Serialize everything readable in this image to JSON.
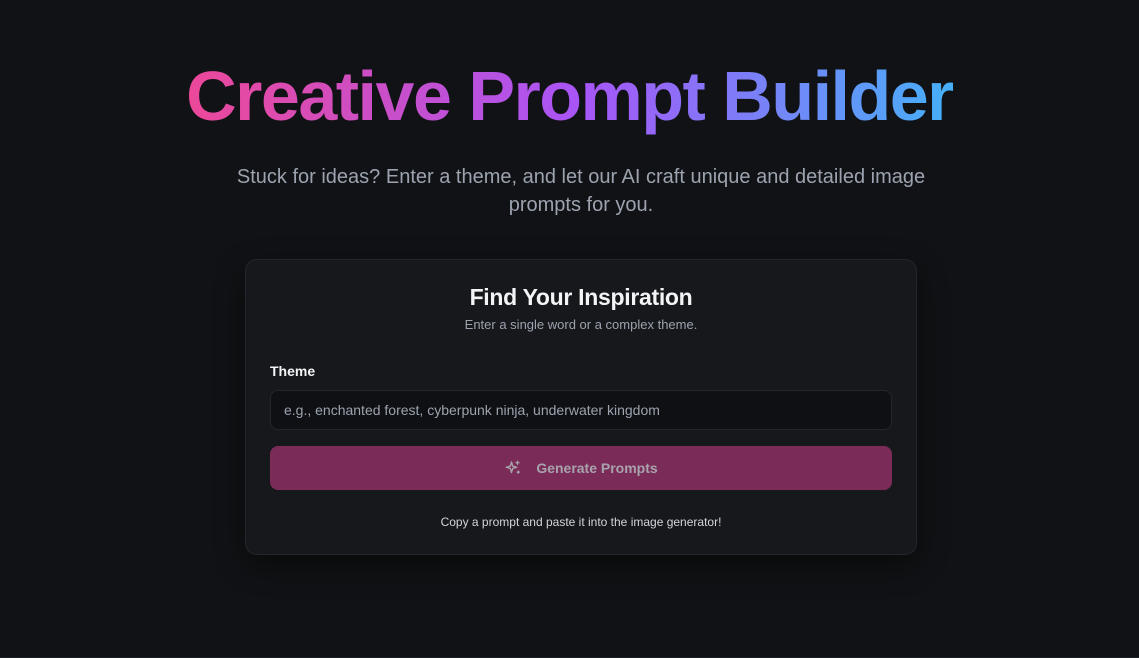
{
  "hero": {
    "title": "Creative Prompt Builder",
    "subtitle": "Stuck for ideas? Enter a theme, and let our AI craft unique and detailed image prompts for you."
  },
  "card": {
    "title": "Find Your Inspiration",
    "subtitle": "Enter a single word or a complex theme.",
    "theme_label": "Theme",
    "theme_input": {
      "value": "",
      "placeholder": "e.g., enchanted forest, cyberpunk ninja, underwater kingdom"
    },
    "generate_button": {
      "label": "Generate Prompts",
      "icon": "sparkles-icon"
    },
    "footer_note": "Copy a prompt and paste it into the image generator!"
  },
  "colors": {
    "background": "#111215",
    "card_background": "#16181c",
    "button_background": "#7a2b58",
    "title_gradient_start": "#ec4899",
    "title_gradient_mid": "#a855f7",
    "title_gradient_end": "#38bdf8"
  }
}
